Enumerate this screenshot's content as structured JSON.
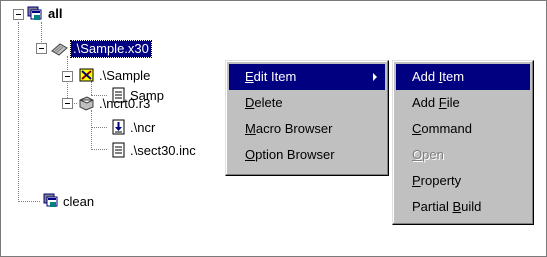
{
  "tree": {
    "root_label": "all",
    "sample_label": ".\\Sample.x30",
    "sample_child_label": ".\\Sample",
    "samp_label": "Samp",
    "ncrt_label": ".\\ncrt0.r3",
    "ncr_label": ".\\ncr",
    "sect_label": ".\\sect30.inc",
    "clean_label": "clean"
  },
  "context_menu": {
    "items": [
      {
        "pre": "",
        "key": "E",
        "post": "dit Item",
        "submenu": true
      },
      {
        "pre": "",
        "key": "D",
        "post": "elete"
      },
      {
        "pre": "",
        "key": "M",
        "post": "acro Browser"
      },
      {
        "pre": "",
        "key": "O",
        "post": "ption Browser"
      }
    ]
  },
  "submenu": {
    "items": [
      {
        "pre": "Add ",
        "key": "I",
        "post": "tem"
      },
      {
        "pre": "Add ",
        "key": "F",
        "post": "ile"
      },
      {
        "pre": "",
        "key": "C",
        "post": "ommand"
      },
      {
        "pre": "",
        "key": "O",
        "post": "pen",
        "disabled": true
      },
      {
        "pre": "",
        "key": "P",
        "post": "roperty"
      },
      {
        "pre": "Partial ",
        "key": "B",
        "post": "uild"
      }
    ]
  },
  "colors": {
    "highlight": "#000080",
    "menu_face": "#c0c0c0",
    "disabled_text": "#808080"
  }
}
